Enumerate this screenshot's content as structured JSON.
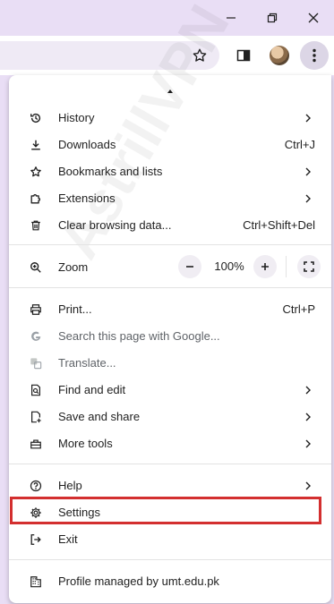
{
  "menu": {
    "items": [
      {
        "id": "history",
        "label": "History",
        "shortcut": "",
        "submenu": true,
        "icon": "history-icon"
      },
      {
        "id": "downloads",
        "label": "Downloads",
        "shortcut": "Ctrl+J",
        "submenu": false,
        "icon": "download-icon"
      },
      {
        "id": "bookmarks",
        "label": "Bookmarks and lists",
        "shortcut": "",
        "submenu": true,
        "icon": "star-icon"
      },
      {
        "id": "extensions",
        "label": "Extensions",
        "shortcut": "",
        "submenu": true,
        "icon": "puzzle-icon"
      },
      {
        "id": "clear",
        "label": "Clear browsing data...",
        "shortcut": "Ctrl+Shift+Del",
        "submenu": false,
        "icon": "trash-icon"
      },
      {
        "id": "print",
        "label": "Print...",
        "shortcut": "Ctrl+P",
        "submenu": false,
        "icon": "printer-icon"
      },
      {
        "id": "search",
        "label": "Search this page with Google...",
        "shortcut": "",
        "submenu": false,
        "icon": "google-icon"
      },
      {
        "id": "translate",
        "label": "Translate...",
        "shortcut": "",
        "submenu": false,
        "icon": "translate-icon"
      },
      {
        "id": "find",
        "label": "Find and edit",
        "shortcut": "",
        "submenu": true,
        "icon": "find-icon"
      },
      {
        "id": "save",
        "label": "Save and share",
        "shortcut": "",
        "submenu": true,
        "icon": "save-icon"
      },
      {
        "id": "moretools",
        "label": "More tools",
        "shortcut": "",
        "submenu": true,
        "icon": "toolbox-icon"
      },
      {
        "id": "help",
        "label": "Help",
        "shortcut": "",
        "submenu": true,
        "icon": "help-icon"
      },
      {
        "id": "settings",
        "label": "Settings",
        "shortcut": "",
        "submenu": false,
        "icon": "gear-icon"
      },
      {
        "id": "exit",
        "label": "Exit",
        "shortcut": "",
        "submenu": false,
        "icon": "exit-icon"
      },
      {
        "id": "profile",
        "label": "Profile managed by umt.edu.pk",
        "shortcut": "",
        "submenu": false,
        "icon": "building-icon"
      }
    ],
    "zoom": {
      "label": "Zoom",
      "value": "100%",
      "minus": "−",
      "plus": "+"
    }
  },
  "watermark": "AstrillVPN",
  "colors": {
    "frame": "#e9def5",
    "highlight": "#d32f2f",
    "disabled": "#5f6368"
  }
}
